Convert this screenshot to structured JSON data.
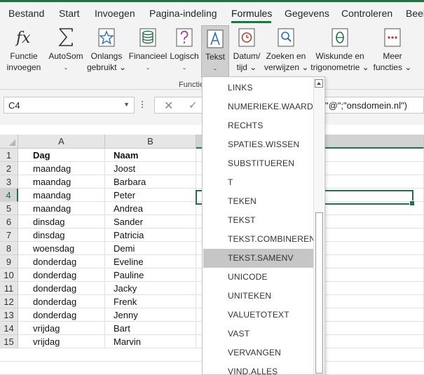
{
  "menu": {
    "tabs": [
      {
        "label": "Bestand"
      },
      {
        "label": "Start"
      },
      {
        "label": "Invoegen"
      },
      {
        "label": "Pagina-indeling"
      },
      {
        "label": "Formules"
      },
      {
        "label": "Gegevens"
      },
      {
        "label": "Controleren"
      },
      {
        "label": "Beel"
      }
    ],
    "active": "Formules"
  },
  "ribbon": {
    "insert_function": {
      "line1": "Functie",
      "line2": "invoegen"
    },
    "autosum": {
      "line1": "AutoSom",
      "caret": "⌄"
    },
    "recent": {
      "line1": "Onlangs",
      "line2": "gebruikt ⌄"
    },
    "financial": {
      "line1": "Financieel",
      "caret": "⌄"
    },
    "logical": {
      "line1": "Logisch",
      "caret": "⌄"
    },
    "text": {
      "line1": "Tekst",
      "caret": "⌄"
    },
    "datetime": {
      "line1": "Datum/",
      "line2": "tijd ⌄"
    },
    "lookup": {
      "line1": "Zoeken en",
      "line2": "verwijzen ⌄"
    },
    "math": {
      "line1": "Wiskunde en",
      "line2": "trigonometrie ⌄"
    },
    "more": {
      "line1": "Meer",
      "line2": "functies ⌄"
    },
    "group_label": "Functie"
  },
  "formula_bar": {
    "name_box": "C4",
    "cancel": "✕",
    "enter": "✓",
    "formula_visible": "\"@\";\"onsdomein.nl\")"
  },
  "grid": {
    "columns": [
      "A",
      "B"
    ],
    "rows": [
      {
        "n": "1",
        "a": "Dag",
        "b": "Naam"
      },
      {
        "n": "2",
        "a": "maandag",
        "b": "Joost"
      },
      {
        "n": "3",
        "a": "maandag",
        "b": "Barbara"
      },
      {
        "n": "4",
        "a": "maandag",
        "b": "Peter"
      },
      {
        "n": "5",
        "a": "maandag",
        "b": "Andrea"
      },
      {
        "n": "6",
        "a": "dinsdag",
        "b": "Sander"
      },
      {
        "n": "7",
        "a": "dinsdag",
        "b": "Patricia"
      },
      {
        "n": "8",
        "a": "woensdag",
        "b": "Demi"
      },
      {
        "n": "9",
        "a": "donderdag",
        "b": "Eveline"
      },
      {
        "n": "10",
        "a": "donderdag",
        "b": "Pauline"
      },
      {
        "n": "11",
        "a": "donderdag",
        "b": "Jacky"
      },
      {
        "n": "12",
        "a": "donderdag",
        "b": "Frenk"
      },
      {
        "n": "13",
        "a": "donderdag",
        "b": "Jenny"
      },
      {
        "n": "14",
        "a": "vrijdag",
        "b": "Bart"
      },
      {
        "n": "15",
        "a": "vrijdag",
        "b": "Marvin"
      }
    ]
  },
  "text_functions": {
    "items": [
      "LINKS",
      "NUMERIEKE.WAARDE",
      "RECHTS",
      "SPATIES.WISSEN",
      "SUBSTITUEREN",
      "T",
      "TEKEN",
      "TEKST",
      "TEKST.COMBINEREN",
      "TEKST.SAMENV",
      "UNICODE",
      "UNITEKEN",
      "VALUETOTEXT",
      "VAST",
      "VERVANGEN",
      "VIND.ALLES"
    ],
    "highlighted": "TEKST.SAMENV"
  },
  "colors": {
    "accent": "#217346",
    "highlight": "#c6c6c6"
  }
}
